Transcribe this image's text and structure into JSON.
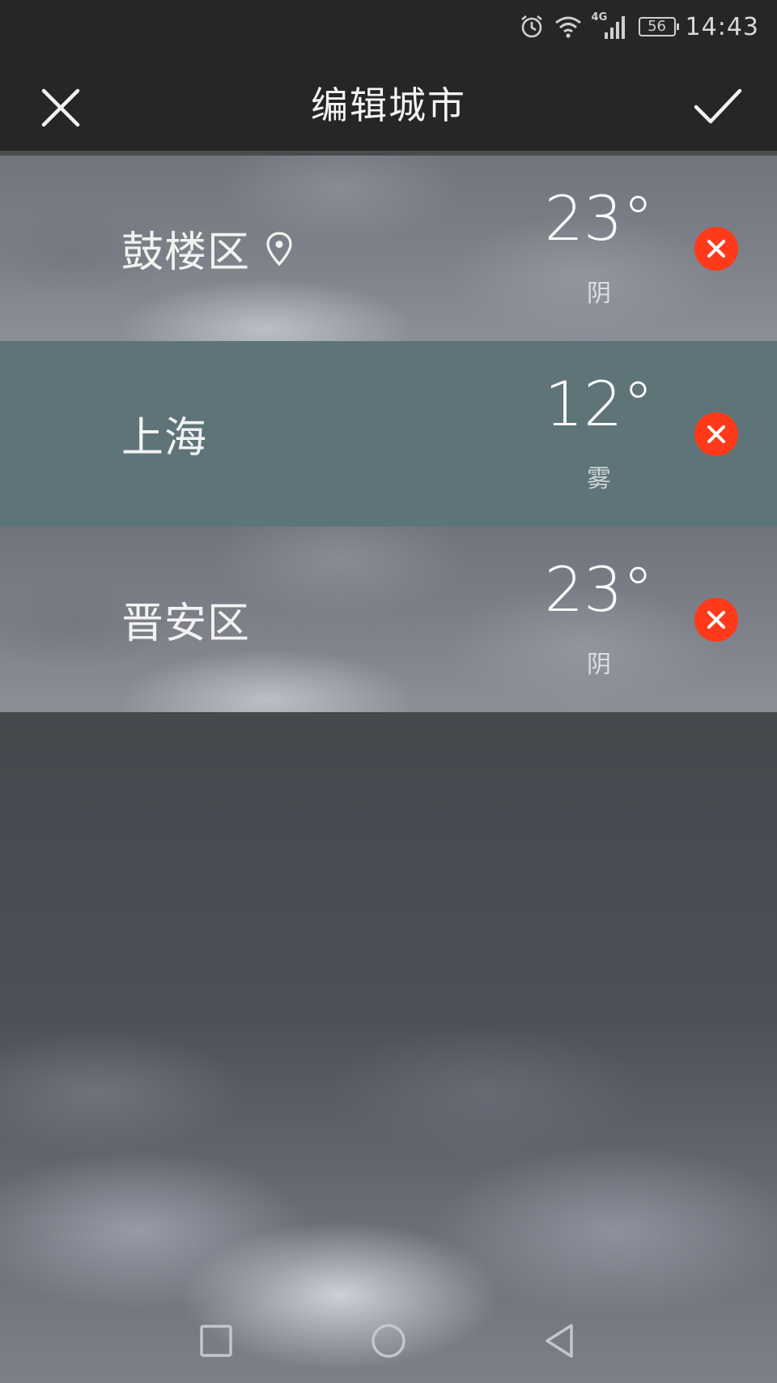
{
  "status_bar": {
    "network": "4G",
    "battery": "56",
    "time": "14:43"
  },
  "header": {
    "title": "编辑城市"
  },
  "cities": [
    {
      "name": "鼓楼区",
      "temp": "23°",
      "condition": "阴",
      "located": true,
      "style": "cloudy"
    },
    {
      "name": "上海",
      "temp": "12°",
      "condition": "雾",
      "located": false,
      "style": "fog"
    },
    {
      "name": "晋安区",
      "temp": "23°",
      "condition": "阴",
      "located": false,
      "style": "cloudy"
    }
  ],
  "colors": {
    "delete_button": "#ff3a1a",
    "fog_row": "#5e7479",
    "title_bar": "#262626"
  },
  "icons": {
    "close": "close-icon",
    "confirm": "check-icon",
    "location": "location-pin-icon",
    "delete": "delete-x-icon",
    "nav_recent": "square-icon",
    "nav_home": "circle-icon",
    "nav_back": "triangle-back-icon"
  }
}
